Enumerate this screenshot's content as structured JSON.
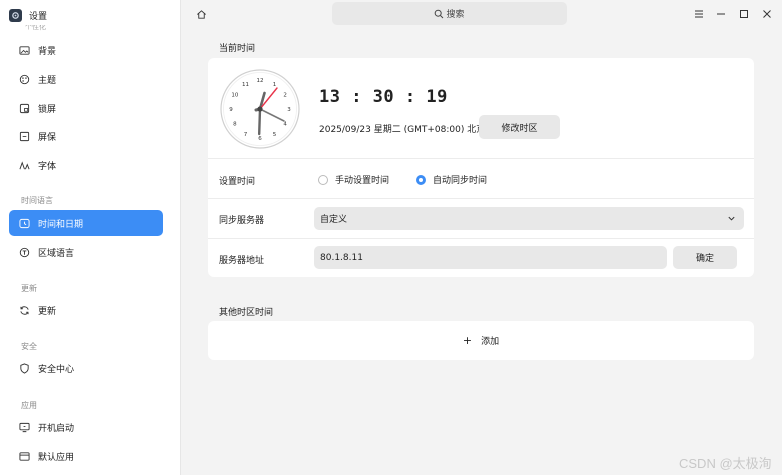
{
  "app": {
    "title": "设置",
    "cut_label": "个性化"
  },
  "sidebar": {
    "items": [
      {
        "label": "背景",
        "icon": "image-icon"
      },
      {
        "label": "主题",
        "icon": "palette-icon"
      },
      {
        "label": "锁屏",
        "icon": "lock-screen-icon"
      },
      {
        "label": "屏保",
        "icon": "screensaver-icon"
      },
      {
        "label": "字体",
        "icon": "font-icon"
      },
      {
        "label": "时间和日期",
        "icon": "clock-icon",
        "active": true
      },
      {
        "label": "区域语言",
        "icon": "globe-icon"
      },
      {
        "label": "更新",
        "icon": "refresh-icon"
      },
      {
        "label": "安全中心",
        "icon": "shield-icon"
      },
      {
        "label": "开机启动",
        "icon": "startup-icon"
      },
      {
        "label": "默认应用",
        "icon": "default-apps-icon"
      }
    ],
    "groups": [
      "时间语言",
      "更新",
      "安全",
      "应用"
    ]
  },
  "topbar": {
    "search_placeholder": "搜索"
  },
  "main": {
    "current_time_title": "当前时间",
    "clock_numbers": [
      "12",
      "1",
      "2",
      "3",
      "4",
      "5",
      "6",
      "7",
      "8",
      "9",
      "10",
      "11"
    ],
    "time": "13 : 30 : 19",
    "date": "2025/09/23 星期二  (GMT+08:00) 北京",
    "change_timezone_button": "修改时区",
    "set_time_label": "设置时间",
    "manual_option": "手动设置时间",
    "auto_option": "自动同步时间",
    "auto_selected": true,
    "sync_server_label": "同步服务器",
    "sync_server_value": "自定义",
    "server_address_label": "服务器地址",
    "server_address_value": "80.1.8.11",
    "confirm_button": "确定",
    "other_tz_title": "其他时区时间",
    "add_label": "添加"
  },
  "watermark": "CSDN @太极洵",
  "colors": {
    "accent": "#3c8df5",
    "second_hand": "#e8344a"
  }
}
